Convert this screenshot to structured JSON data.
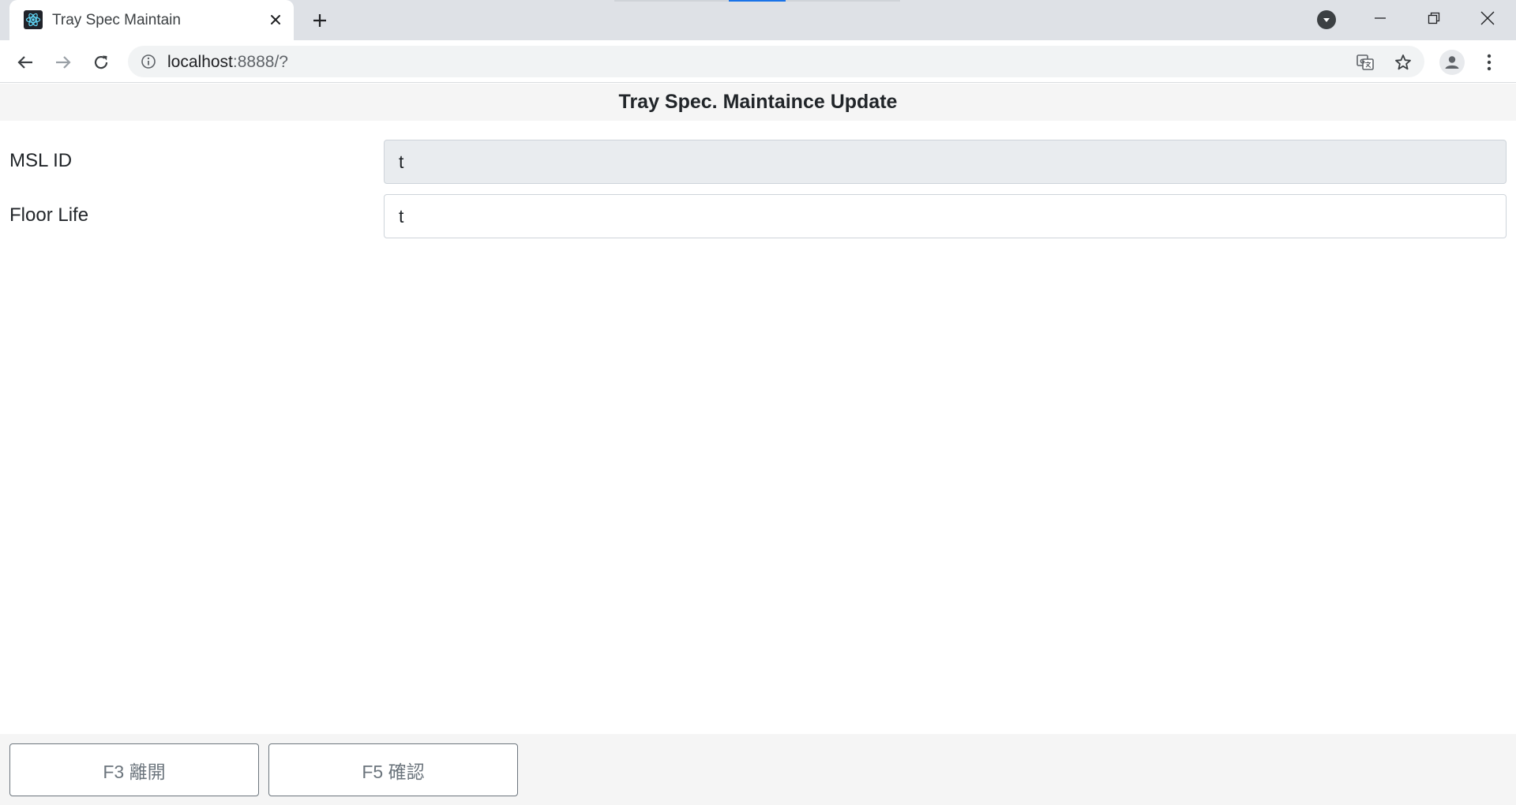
{
  "browser": {
    "tab_title": "Tray Spec Maintain",
    "url_host": "localhost",
    "url_path": ":8888/?"
  },
  "page": {
    "title": "Tray Spec. Maintaince Update"
  },
  "form": {
    "msl_id": {
      "label": "MSL ID",
      "value": "t",
      "readonly": true
    },
    "floor_life": {
      "label": "Floor Life",
      "value": "t"
    }
  },
  "footer": {
    "exit_label": "F3 離開",
    "confirm_label": "F5 確認"
  },
  "colors": {
    "tabstrip_bg": "#dee1e6",
    "header_bg": "#f5f5f5",
    "readonly_input_bg": "#e9ecef",
    "button_text": "#6c757d",
    "accent": "#1a73e8"
  }
}
